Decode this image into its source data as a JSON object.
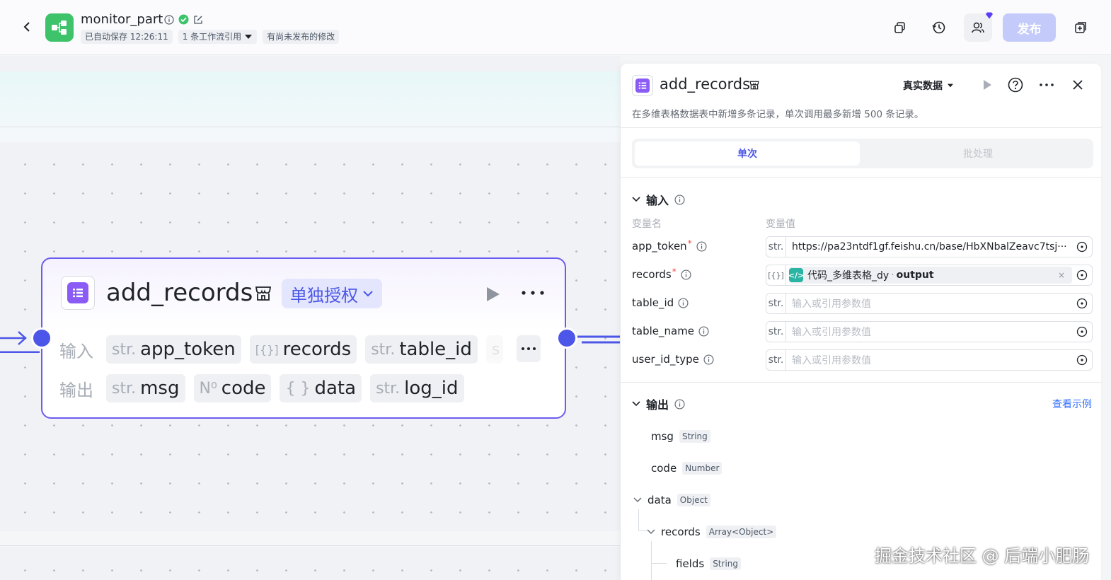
{
  "header": {
    "app_name": "monitor_part",
    "autosave": "已自动保存 12:26:11",
    "references": "1 条工作流引用",
    "unpublished": "有尚未发布的修改",
    "publish_label": "发布"
  },
  "node": {
    "title": "add_records",
    "auth_tag": "单独授权",
    "input_label": "输入",
    "output_label": "输出",
    "inputs": [
      {
        "type": "str.",
        "name": "app_token"
      },
      {
        "type": "[{}]",
        "name": "records"
      },
      {
        "type": "str.",
        "name": "table_id"
      },
      {
        "type": "s",
        "name": ""
      }
    ],
    "outputs": [
      {
        "type": "str.",
        "name": "msg"
      },
      {
        "type": "N⁰",
        "name": "code"
      },
      {
        "type": "{ }",
        "name": "data"
      },
      {
        "type": "str.",
        "name": "log_id"
      }
    ],
    "more": "···"
  },
  "panel": {
    "title": "add_records",
    "mode": "真实数据",
    "description": "在多维表格数据表中新增多条记录，单次调用最多新增 500 条记录。",
    "tab_single": "单次",
    "tab_batch": "批处理",
    "input_section": "输入",
    "col_name": "变量名",
    "col_value": "变量值",
    "params": [
      {
        "name": "app_token",
        "required": "*",
        "type": "str.",
        "value": "https://pa23ntdf1gf.feishu.cn/base/HbXNbalZeavc7tsj···",
        "placeholder": ""
      },
      {
        "name": "records",
        "required": "*",
        "type": "[{}]",
        "value": "",
        "placeholder": ""
      },
      {
        "name": "table_id",
        "required": "",
        "type": "str.",
        "value": "",
        "placeholder": "输入或引用参数值"
      },
      {
        "name": "table_name",
        "required": "",
        "type": "str.",
        "value": "",
        "placeholder": "输入或引用参数值"
      },
      {
        "name": "user_id_type",
        "required": "",
        "type": "str.",
        "value": "",
        "placeholder": "输入或引用参数值"
      }
    ],
    "records_ref": {
      "source": "代码_多维表格_dy",
      "sep": "·",
      "field": "output",
      "clear": "×"
    },
    "output_section": "输出",
    "view_example": "查看示例",
    "outputs": [
      {
        "name": "msg",
        "type": "String"
      },
      {
        "name": "code",
        "type": "Number"
      },
      {
        "name": "data",
        "type": "Object"
      },
      {
        "name": "records",
        "type": "Array<Object>"
      },
      {
        "name": "fields",
        "type": "String"
      }
    ]
  },
  "watermark": "掘金技术社区 @ 后端小肥肠",
  "colors": {
    "accent": "#4c56e8",
    "node_border": "#6b5cf0",
    "logo_green": "#3ec36a",
    "plugin_purple": "#8a5cf5"
  }
}
